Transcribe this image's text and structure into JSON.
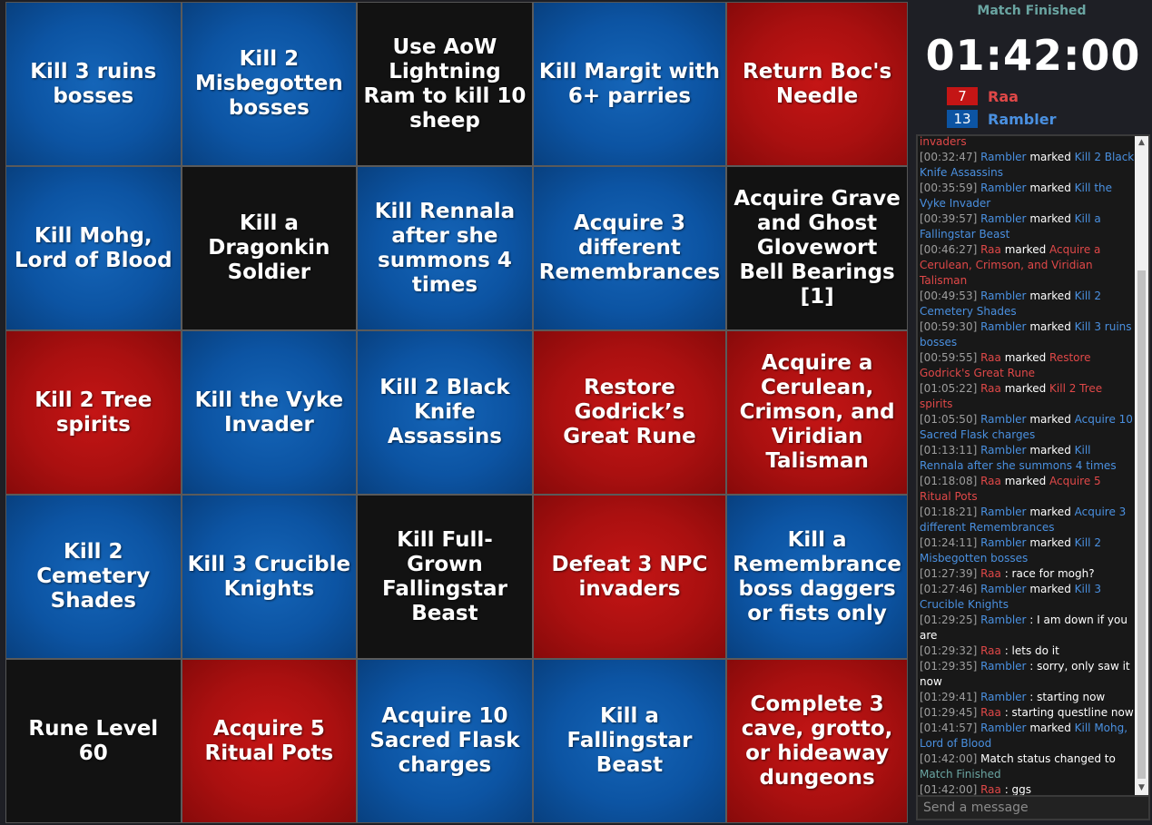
{
  "board": {
    "cells": [
      {
        "text": "Kill 3 ruins bosses",
        "color": "blue"
      },
      {
        "text": "Kill 2 Misbegotten bosses",
        "color": "blue"
      },
      {
        "text": "Use AoW Lightning Ram to kill 10 sheep",
        "color": "black"
      },
      {
        "text": "Kill Margit with 6+ parries",
        "color": "blue"
      },
      {
        "text": "Return Boc's Needle",
        "color": "red"
      },
      {
        "text": "Kill Mohg, Lord of Blood",
        "color": "blue"
      },
      {
        "text": "Kill a Dragonkin Soldier",
        "color": "black"
      },
      {
        "text": "Kill Rennala after she summons 4 times",
        "color": "blue"
      },
      {
        "text": "Acquire 3 different Remembrances",
        "color": "blue"
      },
      {
        "text": "Acquire Grave and Ghost Glovewort Bell Bearings [1]",
        "color": "black"
      },
      {
        "text": "Kill 2 Tree spirits",
        "color": "red"
      },
      {
        "text": "Kill the Vyke Invader",
        "color": "blue"
      },
      {
        "text": "Kill 2 Black Knife Assassins",
        "color": "blue"
      },
      {
        "text": "Restore Godrick’s Great Rune",
        "color": "red"
      },
      {
        "text": "Acquire a Cerulean, Crimson, and Viridian Talisman",
        "color": "red"
      },
      {
        "text": "Kill 2 Cemetery Shades",
        "color": "blue"
      },
      {
        "text": "Kill 3 Crucible Knights",
        "color": "blue"
      },
      {
        "text": "Kill Full-Grown Fallingstar Beast",
        "color": "black"
      },
      {
        "text": "Defeat 3 NPC invaders",
        "color": "red"
      },
      {
        "text": "Kill a Remembrance boss daggers or fists only",
        "color": "blue"
      },
      {
        "text": "Rune Level 60",
        "color": "black"
      },
      {
        "text": "Acquire 5 Ritual Pots",
        "color": "red"
      },
      {
        "text": "Acquire 10 Sacred Flask charges",
        "color": "blue"
      },
      {
        "text": "Kill a Fallingstar Beast",
        "color": "blue"
      },
      {
        "text": "Complete 3 cave, grotto, or hideaway dungeons",
        "color": "red"
      }
    ]
  },
  "match": {
    "status": "Match Finished",
    "timer": "01:42:00"
  },
  "players": [
    {
      "name": "Raa",
      "score": "7",
      "color": "#c41515",
      "text_color": "#e04848"
    },
    {
      "name": "Rambler",
      "score": "13",
      "color": "#0c54a3",
      "text_color": "#4a90e0"
    }
  ],
  "colors": {
    "blue": "#0c54a3",
    "red": "#aa1010",
    "black": "#121212",
    "status_teal": "#6aa5a2"
  },
  "chat": {
    "placeholder": "Send a message",
    "partial_first_line": "invaders",
    "messages": [
      {
        "time": "[00:32:47]",
        "player": "Rambler",
        "team": "blue",
        "type": "mark",
        "verb": "marked",
        "goal": "Kill 2 Black Knife Assassins"
      },
      {
        "time": "[00:35:59]",
        "player": "Rambler",
        "team": "blue",
        "type": "mark",
        "verb": "marked",
        "goal": "Kill the Vyke Invader"
      },
      {
        "time": "[00:39:57]",
        "player": "Rambler",
        "team": "blue",
        "type": "mark",
        "verb": "marked",
        "goal": "Kill a Fallingstar Beast"
      },
      {
        "time": "[00:46:27]",
        "player": "Raa",
        "team": "red",
        "type": "mark",
        "verb": "marked",
        "goal": "Acquire a Cerulean, Crimson, and Viridian Talisman"
      },
      {
        "time": "[00:49:53]",
        "player": "Rambler",
        "team": "blue",
        "type": "mark",
        "verb": "marked",
        "goal": "Kill 2 Cemetery Shades"
      },
      {
        "time": "[00:59:30]",
        "player": "Rambler",
        "team": "blue",
        "type": "mark",
        "verb": "marked",
        "goal": "Kill 3 ruins bosses"
      },
      {
        "time": "[00:59:55]",
        "player": "Raa",
        "team": "red",
        "type": "mark",
        "verb": "marked",
        "goal": "Restore Godrick's Great Rune"
      },
      {
        "time": "[01:05:22]",
        "player": "Raa",
        "team": "red",
        "type": "mark",
        "verb": "marked",
        "goal": "Kill 2 Tree spirits"
      },
      {
        "time": "[01:05:50]",
        "player": "Rambler",
        "team": "blue",
        "type": "mark",
        "verb": "marked",
        "goal": "Acquire 10 Sacred Flask charges"
      },
      {
        "time": "[01:13:11]",
        "player": "Rambler",
        "team": "blue",
        "type": "mark",
        "verb": "marked",
        "goal": "Kill Rennala after she summons 4 times"
      },
      {
        "time": "[01:18:08]",
        "player": "Raa",
        "team": "red",
        "type": "mark",
        "verb": "marked",
        "goal": "Acquire 5 Ritual Pots"
      },
      {
        "time": "[01:18:21]",
        "player": "Rambler",
        "team": "blue",
        "type": "mark",
        "verb": "marked",
        "goal": "Acquire 3 different Remembrances"
      },
      {
        "time": "[01:24:11]",
        "player": "Rambler",
        "team": "blue",
        "type": "mark",
        "verb": "marked",
        "goal": "Kill 2 Misbegotten bosses"
      },
      {
        "time": "[01:27:39]",
        "player": "Raa",
        "team": "red",
        "type": "msg",
        "text": "race for mogh?"
      },
      {
        "time": "[01:27:46]",
        "player": "Rambler",
        "team": "blue",
        "type": "mark",
        "verb": "marked",
        "goal": "Kill 3 Crucible Knights"
      },
      {
        "time": "[01:29:25]",
        "player": "Rambler",
        "team": "blue",
        "type": "msg",
        "text": "I am down if you are"
      },
      {
        "time": "[01:29:32]",
        "player": "Raa",
        "team": "red",
        "type": "msg",
        "text": "lets do it"
      },
      {
        "time": "[01:29:35]",
        "player": "Rambler",
        "team": "blue",
        "type": "msg",
        "text": "sorry, only saw it now"
      },
      {
        "time": "[01:29:41]",
        "player": "Rambler",
        "team": "blue",
        "type": "msg",
        "text": "starting now"
      },
      {
        "time": "[01:29:45]",
        "player": "Raa",
        "team": "red",
        "type": "msg",
        "text": "starting questline now"
      },
      {
        "time": "[01:41:57]",
        "player": "Rambler",
        "team": "blue",
        "type": "mark",
        "verb": "marked",
        "goal": "Kill Mohg, Lord of Blood"
      },
      {
        "time": "[01:42:00]",
        "type": "system",
        "text": "Match status changed to",
        "status": "Match Finished"
      },
      {
        "time": "[01:42:00]",
        "player": "Raa",
        "team": "red",
        "type": "msg",
        "text": "ggs"
      }
    ]
  }
}
